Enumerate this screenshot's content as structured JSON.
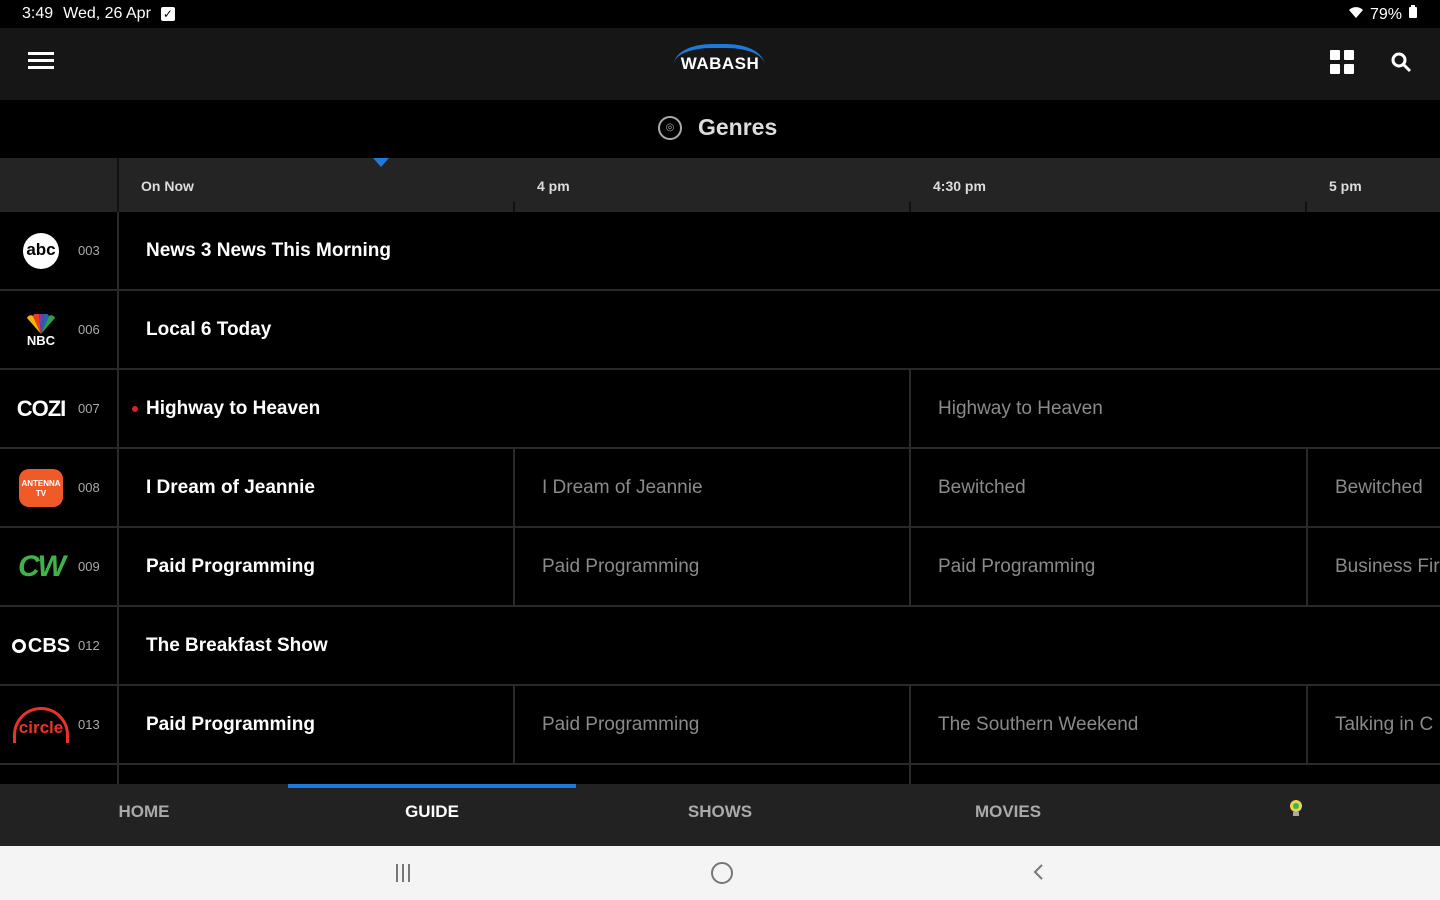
{
  "status_bar": {
    "time": "3:49",
    "date": "Wed, 26 Apr",
    "battery": "79%"
  },
  "header": {
    "logo_text": "WABASH"
  },
  "genres": {
    "label": "Genres"
  },
  "timeline": {
    "labels": [
      "On Now",
      "4 pm",
      "4:30 pm",
      "5 pm"
    ]
  },
  "channels": [
    {
      "logo": "abc",
      "number": "003",
      "programs": [
        "News 3 News This Morning"
      ]
    },
    {
      "logo": "NBC",
      "number": "006",
      "programs": [
        "Local 6 Today"
      ]
    },
    {
      "logo": "COZI",
      "number": "007",
      "programs": [
        "Highway to Heaven",
        "Highway to Heaven"
      ]
    },
    {
      "logo": "ANTENNA TV",
      "number": "008",
      "programs": [
        "I Dream of Jeannie",
        "I Dream of Jeannie",
        "Bewitched",
        "Bewitched"
      ]
    },
    {
      "logo": "CW",
      "number": "009",
      "programs": [
        "Paid Programming",
        "Paid Programming",
        "Paid Programming",
        "Business Fir"
      ]
    },
    {
      "logo": "CBS",
      "number": "012",
      "programs": [
        "The Breakfast Show"
      ]
    },
    {
      "logo": "circle",
      "number": "013",
      "programs": [
        "Paid Programming",
        "Paid Programming",
        "The Southern Weekend",
        "Talking in C"
      ]
    }
  ],
  "bottom_nav": {
    "home": "HOME",
    "guide": "GUIDE",
    "shows": "SHOWS",
    "movies": "MOVIES"
  },
  "colors": {
    "accent": "#1e7ad6",
    "live_dot": "#e01e1e"
  }
}
